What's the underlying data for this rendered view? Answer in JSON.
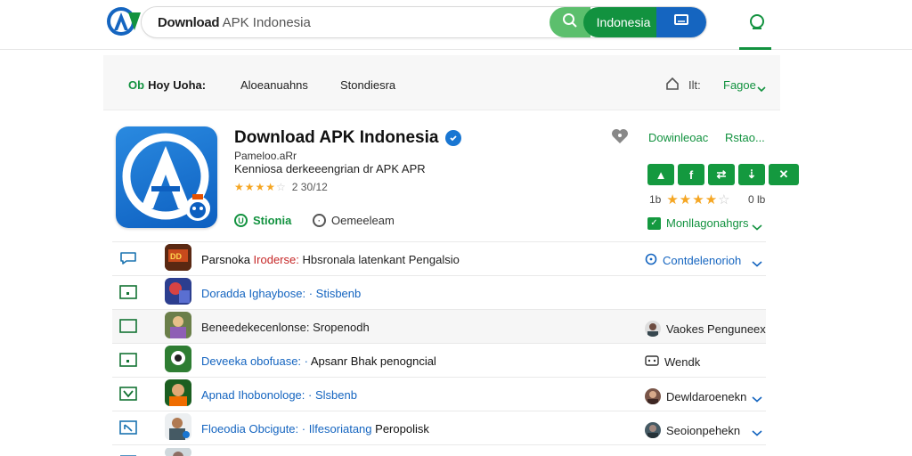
{
  "colors": {
    "brand_green": "#12923f",
    "light_green": "#5cbf6d",
    "brand_blue": "#1565c0",
    "star": "#f5a623"
  },
  "search": {
    "brand": "Download",
    "placeholder_rest": " APK Indonesia",
    "region": "Indonesia",
    "icons": [
      "search-icon",
      "message-icon"
    ]
  },
  "header": {
    "user_icon": "user-icon"
  },
  "subnav": {
    "brand_mark": "Ob",
    "brand_label": "Hoy Uoha:",
    "item2": "Aloeanuahns",
    "item3": "Stondiesra",
    "lang": "Ilt:",
    "page": "Fagoe"
  },
  "app": {
    "title": "Download APK Indonesia",
    "subtitle": "Pameloo.aRr",
    "description": "Kenniosa derkeeengrian dr APK APR",
    "rating_stars": 3.5,
    "rating_text": "2 30/12",
    "tag1": "Stionia",
    "tag2": "Oemeeleam"
  },
  "side": {
    "download_link": "Dowinleoac",
    "link2": "Rstao...",
    "share_buttons": [
      "▲",
      "f",
      "⇄",
      "⇣",
      "✕"
    ],
    "rating_prefix": "1b",
    "rating_stars": 4,
    "rating_count": "0 lb",
    "status": "Monllagonahgrs"
  },
  "list": [
    {
      "icon": "chat-icon",
      "title": "Parsnoka",
      "title2": "Iroderse:",
      "title2_color": "red",
      "desc": "Hbsronala latenkant Pengalsio",
      "right": "Contdelenorioh",
      "right_icon": "info-icon",
      "right_blue": true,
      "chevron": true,
      "shaded": false
    },
    {
      "icon": "square-dot-icon",
      "title": "Doradda",
      "title2": "Ighaybose: · Stisbenb",
      "title2_color": "blue",
      "desc": "",
      "right": "",
      "right_icon": "",
      "right_blue": false,
      "chevron": false,
      "shaded": false
    },
    {
      "icon": "square-icon",
      "title": "Beneedekecenlonse:",
      "title2": "",
      "title2_color": "dark",
      "desc": "Sropenodh",
      "right": "Vaokes Penguneex",
      "right_icon": "avatar",
      "right_blue": false,
      "chevron": false,
      "shaded": true
    },
    {
      "icon": "square-dot-icon",
      "title": "Deveeka",
      "title2": "obofuase: ·",
      "title2_color": "blue",
      "desc": "Apsanr Bhak penogncial",
      "right": "Wendk",
      "right_icon": "gamepad-icon",
      "right_blue": false,
      "chevron": false,
      "shaded": false
    },
    {
      "icon": "check-square-icon",
      "title": "Apnad",
      "title2": "Ihobonologe: · Slsbenb",
      "title2_color": "blue",
      "desc": "",
      "right": "Dewldaroenekn",
      "right_icon": "avatar",
      "right_blue": false,
      "chevron": true,
      "shaded": false
    },
    {
      "icon": "arrow-square-icon",
      "title": "Floeodia",
      "title2": "Obcigute: · Ilfesoriatang",
      "title2_color": "blue",
      "desc": "Peropolisk",
      "right": "Seoionpehekn",
      "right_icon": "avatar",
      "right_blue": false,
      "chevron": true,
      "shaded": false
    }
  ]
}
